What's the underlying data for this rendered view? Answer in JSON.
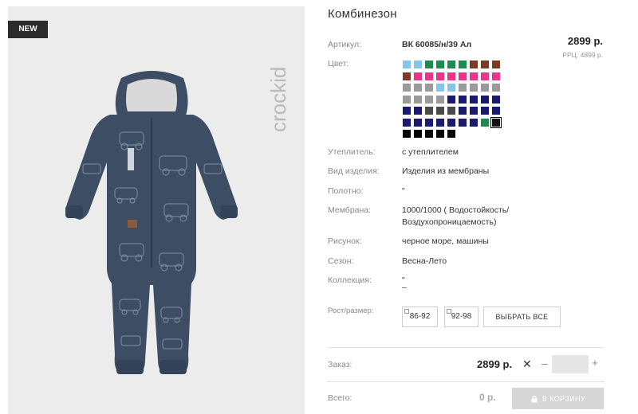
{
  "badge": "NEW",
  "brand": "crockid",
  "product": {
    "title": "Комбинезон",
    "price": "2899 р.",
    "rrp": "РРЦ: 4899 р."
  },
  "labels": {
    "article": "Артикул:",
    "color": "Цвет:",
    "insulation": "Утеплитель:",
    "product_type": "Вид изделия:",
    "fabric": "Полотно:",
    "membrane": "Мембрана:",
    "pattern": "Рисунок:",
    "season": "Сезон:",
    "collection": "Коллекция:",
    "size": "Рост/размер:",
    "order": "Заказ:",
    "total": "Всего:"
  },
  "values": {
    "article": "ВК 60085/н/39 Ал",
    "insulation": "с утеплителем",
    "product_type": "Изделия из мембраны",
    "fabric": "\"",
    "membrane_line1": "1000/1000 ( Водостойкость/",
    "membrane_line2": "Воздухопроницаемость)",
    "pattern": "черное море, машины",
    "season": "Весна-Лето",
    "collection_line1": "\"",
    "collection_line2": "–"
  },
  "swatch_colors": [
    [
      "#86c4ee",
      "#86c4ee",
      "#1e8a52",
      "#1e8a52",
      "#1e8a52",
      "#1e8a52",
      "#7a3b22",
      "#7a3b22",
      "#7a3b22"
    ],
    [
      "#7a3b22",
      "#e8348a",
      "#e8348a",
      "#e8348a",
      "#e8348a",
      "#e8348a",
      "#e8348a",
      "#e8348a",
      "#e8348a"
    ],
    [
      "#9a9a9a",
      "#9a9a9a",
      "#9a9a9a",
      "#86c4ee",
      "#86c4ee",
      "#9a9a9a",
      "#9a9a9a",
      "#9a9a9a",
      "#9a9a9a"
    ],
    [
      "#9a9a9a",
      "#9a9a9a",
      "#9a9a9a",
      "#9a9a9a",
      "#1a1a6e",
      "#1a1a6e",
      "#1a1a6e",
      "#1a1a6e",
      "#1a1a6e"
    ],
    [
      "#1a1a6e",
      "#1a1a6e",
      "#4a4a4a",
      "#4a4a4a",
      "#4a4a4a",
      "#1a1a6e",
      "#1a1a6e",
      "#1a1a6e",
      "#1a1a6e"
    ],
    [
      "#1a1a6e",
      "#1a1a6e",
      "#1a1a6e",
      "#1a1a6e",
      "#1a1a6e",
      "#1a1a6e",
      "#1a1a6e",
      "#1e8a52",
      "#111111"
    ],
    [
      "#000000",
      "#000000",
      "#000000",
      "#000000",
      "#000000"
    ]
  ],
  "selected_swatch": "row6-col9",
  "sizes": [
    "86-92",
    "92-98"
  ],
  "select_all_label": "ВЫБРАТЬ ВСЕ",
  "order": {
    "price": "2899 р.",
    "times": "✕",
    "minus": "–",
    "plus": "+",
    "quantity": ""
  },
  "total": {
    "value": "0 р.",
    "cart_label": "В КОРЗИНУ",
    "cart_icon": "lock-icon"
  },
  "colors": {
    "badge_bg": "#2b2b2b",
    "image_bg": "#ececec",
    "garment": "#3d4d63",
    "cart_button_bg": "#d6d6d6"
  }
}
